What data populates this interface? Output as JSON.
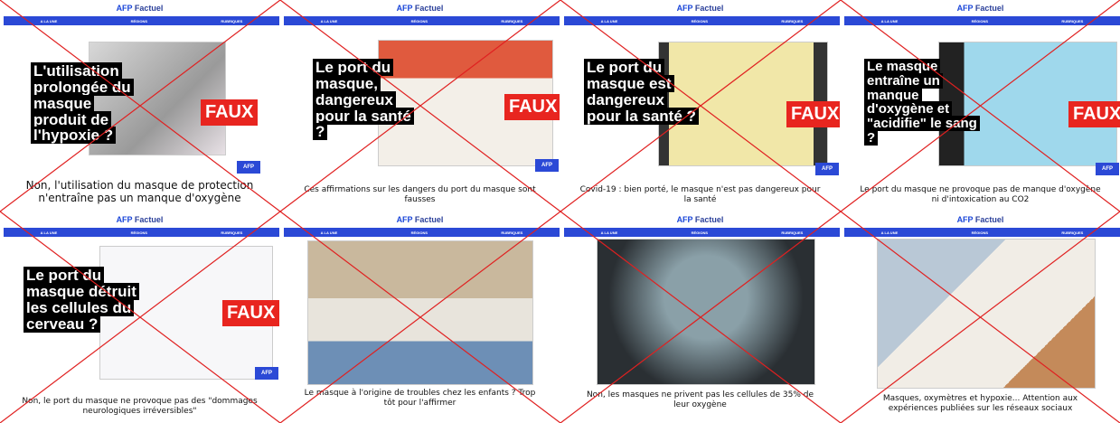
{
  "brand": {
    "afp": "AFP",
    "factuel": "Factuel"
  },
  "nav": [
    "A LA UNE",
    "RÉGIONS",
    "RUBRIQUES"
  ],
  "tiles": [
    {
      "headline": "L'utilisation prolongée du masque produit de l'hypoxie ?",
      "verdict": "FAUX",
      "badge": "AFP",
      "caption": "Non, l'utilisation du masque de protection n'entraîne pas un manque d'oxygène"
    },
    {
      "headline": "Le port du masque, dangereux pour la santé ?",
      "verdict": "FAUX",
      "badge": "AFP",
      "caption": "Ces affirmations sur les dangers du port du masque sont fausses"
    },
    {
      "headline": "Le port du masque est dangereux pour la santé ?",
      "verdict": "FAUX",
      "badge": "AFP",
      "caption": "Covid-19 : bien porté, le masque n'est pas dangereux pour la santé"
    },
    {
      "headline": "Le masque entraîne un manque d'oxygène et \"acidifie\" le sang ?",
      "verdict": "FAUX",
      "badge": "AFP",
      "caption": "Le port du masque ne provoque pas de manque d'oxygène ni d'intoxication au CO2"
    },
    {
      "headline": "Le port du masque détruit les cellules du cerveau ?",
      "verdict": "FAUX",
      "badge": "AFP",
      "caption": "Non, le port du masque ne provoque pas des \"dommages neurologiques irréversibles\""
    },
    {
      "caption": "Le masque à l'origine de troubles chez les enfants ? Trop tôt pour l'affirmer"
    },
    {
      "caption": "Non, les masques ne privent pas les cellules de 35% de leur oxygène"
    },
    {
      "caption": "Masques, oxymètres et hypoxie... Attention aux expériences publiées sur les réseaux sociaux"
    }
  ],
  "colors": {
    "brand_blue": "#2b49d6",
    "verdict_red": "#e8251f",
    "cross_red": "#e02020"
  }
}
